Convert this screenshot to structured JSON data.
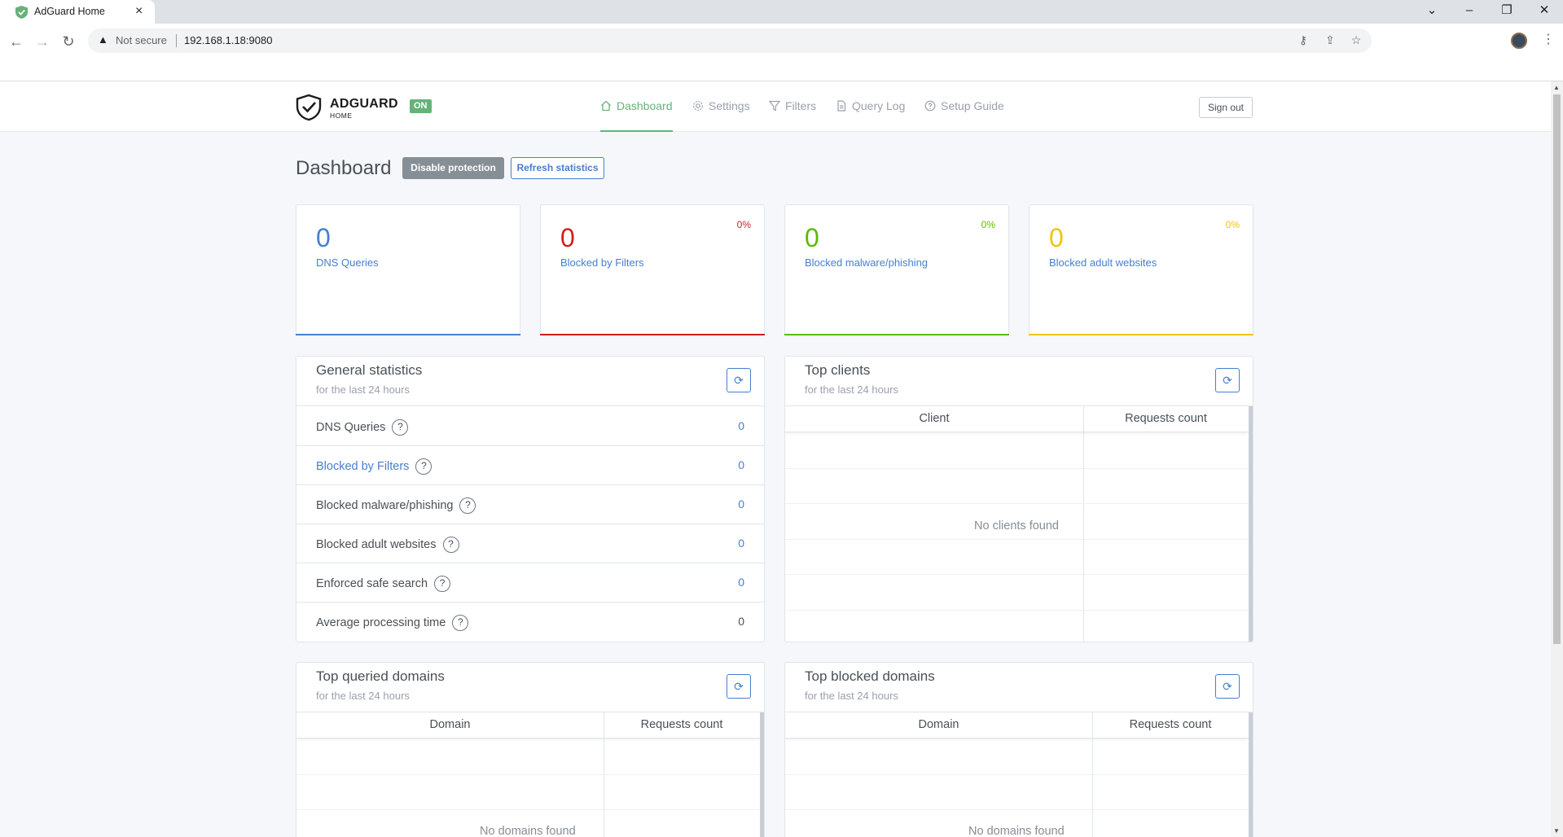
{
  "browser": {
    "tab_title": "AdGuard Home",
    "tab_close": "×",
    "security_label": "Not secure",
    "url": "192.168.1.18:9080"
  },
  "header": {
    "logo_text": "ADGUARD",
    "logo_sub": "HOME",
    "status_badge": "ON",
    "nav": [
      {
        "label": "Dashboard",
        "icon": "home-icon",
        "active": true
      },
      {
        "label": "Settings",
        "icon": "gear-icon",
        "active": false
      },
      {
        "label": "Filters",
        "icon": "filter-icon",
        "active": false
      },
      {
        "label": "Query Log",
        "icon": "document-icon",
        "active": false
      },
      {
        "label": "Setup Guide",
        "icon": "help-circle-icon",
        "active": false
      }
    ],
    "signout_label": "Sign out"
  },
  "page": {
    "title": "Dashboard",
    "disable_label": "Disable protection",
    "refresh_label": "Refresh statistics"
  },
  "colors": {
    "accent_green": "#67b279",
    "blue": "#467fcf",
    "red": "#cd201f",
    "green": "#5eba00",
    "yellow": "#f1c40f"
  },
  "stats": [
    {
      "value": "0",
      "label": "DNS Queries",
      "percent": "",
      "color": "#467fcf"
    },
    {
      "value": "0",
      "label": "Blocked by Filters",
      "percent": "0%",
      "color": "#cd201f"
    },
    {
      "value": "0",
      "label": "Blocked malware/phishing",
      "percent": "0%",
      "color": "#5eba00"
    },
    {
      "value": "0",
      "label": "Blocked adult websites",
      "percent": "0%",
      "color": "#f1c40f"
    }
  ],
  "general_stats": {
    "title": "General statistics",
    "subtitle": "for the last 24 hours",
    "help_glyph": "?",
    "rows": [
      {
        "label": "DNS Queries",
        "value": "0"
      },
      {
        "label": "Blocked by Filters",
        "value": "0"
      },
      {
        "label": "Blocked malware/phishing",
        "value": "0"
      },
      {
        "label": "Blocked adult websites",
        "value": "0"
      },
      {
        "label": "Enforced safe search",
        "value": "0"
      },
      {
        "label": "Average processing time",
        "value": "0"
      }
    ]
  },
  "top_clients": {
    "title": "Top clients",
    "subtitle": "for the last 24 hours",
    "columns": [
      "Client",
      "Requests count"
    ],
    "empty": "No clients found"
  },
  "top_queried": {
    "title": "Top queried domains",
    "subtitle": "for the last 24 hours",
    "columns": [
      "Domain",
      "Requests count"
    ],
    "empty": "No domains found"
  },
  "top_blocked": {
    "title": "Top blocked domains",
    "subtitle": "for the last 24 hours",
    "columns": [
      "Domain",
      "Requests count"
    ],
    "empty": "No domains found"
  }
}
